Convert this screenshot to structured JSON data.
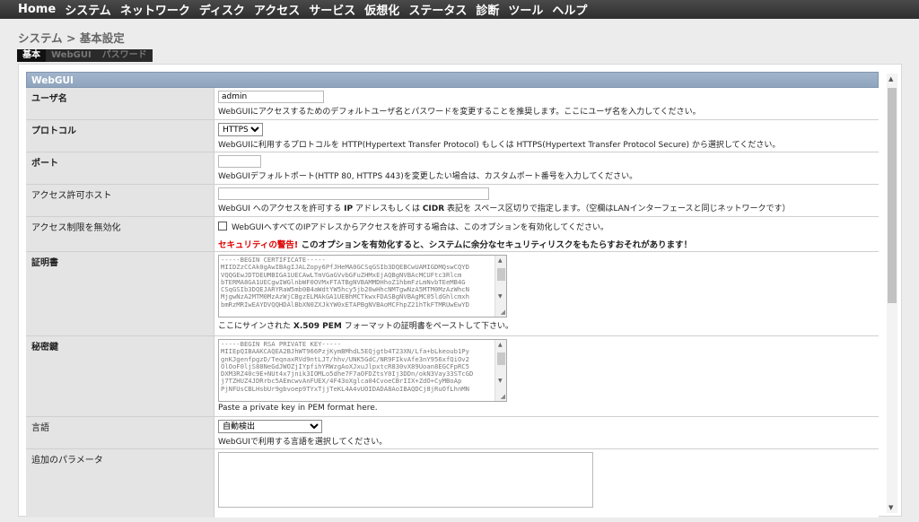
{
  "nav": {
    "items": [
      "Home",
      "システム",
      "ネットワーク",
      "ディスク",
      "アクセス",
      "サービス",
      "仮想化",
      "ステータス",
      "診断",
      "ツール",
      "ヘルプ"
    ]
  },
  "breadcrumb": "システム > 基本設定",
  "tabs": [
    {
      "label": "基本",
      "active": true
    },
    {
      "label": "WebGUI",
      "active": false
    },
    {
      "label": "パスワード",
      "active": false
    }
  ],
  "section_title": "WebGUI",
  "form": {
    "username": {
      "label": "ユーザ名",
      "value": "admin",
      "desc": "WebGUIにアクセスするためのデフォルトユーザ名とパスワードを変更することを推奨します。ここにユーザ名を入力してください。"
    },
    "protocol": {
      "label": "プロトコル",
      "value": "HTTPS",
      "desc": "WebGUIに利用するプロトコルを HTTP(Hypertext Transfer Protocol) もしくは HTTPS(Hypertext Transfer Protocol Secure) から選択してください。"
    },
    "port": {
      "label": "ポート",
      "value": "",
      "desc": "WebGUIデフォルトポート(HTTP 80, HTTPS 443)を変更したい場合は、カスタムポート番号を入力してください。"
    },
    "allowed_hosts": {
      "label": "アクセス許可ホスト",
      "value": "",
      "desc_pre": "WebGUI へのアクセスを許可する ",
      "desc_b1": "IP",
      "desc_mid": " アドレスもしくは ",
      "desc_b2": "CIDR",
      "desc_post": " 表記を スペース区切りで指定します。（空欄はLANインターフェースと同じネットワークです）"
    },
    "disable_restriction": {
      "label": "アクセス制限を無効化",
      "checkbox_label": "WebGUIへすべてのIPアドレスからアクセスを許可する場合は、このオプションを有効化してください。",
      "warning_red": "セキュリティの警告!",
      "warning_text": " このオプションを有効化すると、システムに余分なセキュリティリスクをもたらすおそれがあります！"
    },
    "certificate": {
      "label": "証明書",
      "content": "-----BEGIN CERTIFICATE-----\nMIIDZzCCAk0gAwIBAgIJALZopy6PfJHeMA0GCSqGSIb3DQEBCwUAMIGDMQswCQYD\nVQQGEwJDTDEUMBIGA1UECAwLTmVGaGVvbGFuZHMxEjAQBgNVBAcMCUFtc3Rlcm\nbTERMA8GA1UECgwIWGlnbWF0OVMxFTATBgNVBAMMDHhoZ1hbmFzLmNvbTEeMB4G\nCSqGSIb3DQEJARYRaW5mb0B4aWdtYW5hcy5jb20wHhcNMTgwNzA5MTM0MzAzWhcN\nMjgwNzA2MTM0MzAzWjCBgzELMAkGA1UEBhMCTkwxFDASBgNVBAgMC05ldGhlcmxh\nbmRzMRIwEAYDVQQHDAlBbXN0ZXJkYW0xETAPBgNVBAoMCFhpZ21hTkFTMRUwEwYD",
      "desc_pre": "ここにサインされた ",
      "desc_b": "X.509 PEM",
      "desc_post": " フォーマットの証明書をペーストして下さい。"
    },
    "private_key": {
      "label": "秘密鍵",
      "content": "-----BEGIN RSA PRIVATE KEY-----\nMIIEpQIBAAKCAQEA2BJhWT966PzjKymBMhdL5EQjgtb4T23XN/Lfa+bLkeoub1Py\ngnKJgenfpgzD/TeqnaxRVd9ntLJT/hhv/UNK5GdC/NR9FIkvAfe3nY956xfQiOv2\nOlOoF0ljS88NeGdJWOZjIYpfihYRWzgAoXJxuJlpxtcR830vX89Uoan8EGCFpRC5\nDXM3RZ40c9E+NUt4x7jnik3IOMLo5dhe7F7aOFDZtsY0Ij3DDn/okN3Vay33STcGD\nj7TZHUZ4JDRrbc5AEmcwvAnFUEX/4F43oXglca04CvoeCBrIIX+ZdO+CyMBoAp\nPjNFUsCBLHsbUr9gbvoep9TYxTjjTeKL4A4vUOIDADA8AoIBAQDCj8jRuOfLhnMN",
      "desc": "Paste a private key in PEM format here."
    },
    "language": {
      "label": "言語",
      "value": "自動検出",
      "desc": "WebGUIで利用する言語を選択してください。"
    },
    "extra_params": {
      "label": "追加のパラメータ",
      "value": ""
    }
  },
  "colors": {
    "topnav_bg": "#333333",
    "section_header_bg": "#96aac2",
    "warning_red": "#dd0000",
    "label_bg": "#e4e4e4"
  }
}
